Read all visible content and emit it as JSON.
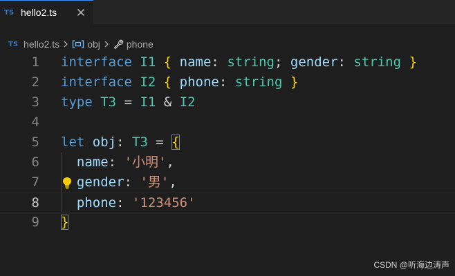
{
  "tab": {
    "badge": "TS",
    "filename": "hello2.ts",
    "close_icon": "close-icon"
  },
  "breadcrumb": {
    "badge": "TS",
    "file": "hello2.ts",
    "symbol_icon": "variable-icon",
    "symbol": "obj",
    "property_icon": "wrench-icon",
    "property": "phone"
  },
  "editor": {
    "current_line": 8,
    "lines": [
      {
        "number": "1"
      },
      {
        "number": "2"
      },
      {
        "number": "3"
      },
      {
        "number": "4"
      },
      {
        "number": "5"
      },
      {
        "number": "6"
      },
      {
        "number": "7"
      },
      {
        "number": "8"
      },
      {
        "number": "9"
      }
    ],
    "code": {
      "l1": {
        "k": "interface",
        "name": "I1",
        "ob": "{",
        "p1": "name",
        "t1": "string",
        "semi": ";",
        "p2": "gender",
        "t2": "string",
        "cb": "}"
      },
      "l2": {
        "k": "interface",
        "name": "I2",
        "ob": "{",
        "p1": "phone",
        "t1": "string",
        "cb": "}"
      },
      "l3": {
        "k": "type",
        "name": "T3",
        "eq": "=",
        "a": "I1",
        "amp": "&",
        "b": "I2"
      },
      "l5": {
        "k": "let",
        "var": "obj",
        "colon": ":",
        "type": "T3",
        "eq": "=",
        "ob": "{"
      },
      "l6": {
        "prop": "name",
        "val": "'小明'",
        "comma": ","
      },
      "l7": {
        "prop": "gender",
        "val": "'男'",
        "comma": ","
      },
      "l8": {
        "prop": "phone",
        "val": "'123456'"
      },
      "l9": {
        "cb": "}"
      }
    },
    "lightbulb_icon": "lightbulb-icon"
  },
  "watermark": "CSDN @听海边涛声",
  "colors": {
    "background": "#1e1e1e",
    "keyword": "#569cd6",
    "type": "#4ec9b0",
    "property": "#9cdcfe",
    "string": "#ce9178",
    "bracket": "#ffd700",
    "ts_badge": "#3178c6"
  }
}
